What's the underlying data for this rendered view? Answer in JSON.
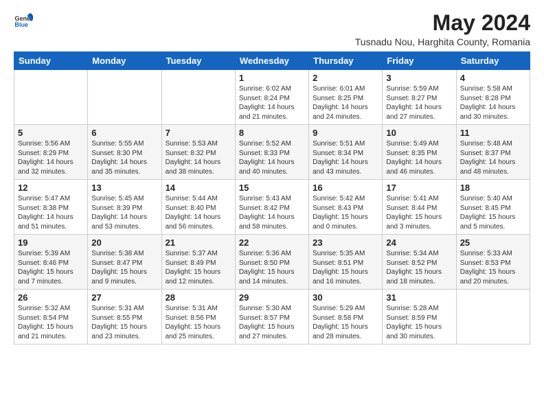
{
  "logo": {
    "general": "General",
    "blue": "Blue"
  },
  "title": "May 2024",
  "subtitle": "Tusnadu Nou, Harghita County, Romania",
  "weekdays": [
    "Sunday",
    "Monday",
    "Tuesday",
    "Wednesday",
    "Thursday",
    "Friday",
    "Saturday"
  ],
  "weeks": [
    [
      {
        "day": "",
        "content": ""
      },
      {
        "day": "",
        "content": ""
      },
      {
        "day": "",
        "content": ""
      },
      {
        "day": "1",
        "content": "Sunrise: 6:02 AM\nSunset: 8:24 PM\nDaylight: 14 hours\nand 21 minutes."
      },
      {
        "day": "2",
        "content": "Sunrise: 6:01 AM\nSunset: 8:25 PM\nDaylight: 14 hours\nand 24 minutes."
      },
      {
        "day": "3",
        "content": "Sunrise: 5:59 AM\nSunset: 8:27 PM\nDaylight: 14 hours\nand 27 minutes."
      },
      {
        "day": "4",
        "content": "Sunrise: 5:58 AM\nSunset: 8:28 PM\nDaylight: 14 hours\nand 30 minutes."
      }
    ],
    [
      {
        "day": "5",
        "content": "Sunrise: 5:56 AM\nSunset: 8:29 PM\nDaylight: 14 hours\nand 32 minutes."
      },
      {
        "day": "6",
        "content": "Sunrise: 5:55 AM\nSunset: 8:30 PM\nDaylight: 14 hours\nand 35 minutes."
      },
      {
        "day": "7",
        "content": "Sunrise: 5:53 AM\nSunset: 8:32 PM\nDaylight: 14 hours\nand 38 minutes."
      },
      {
        "day": "8",
        "content": "Sunrise: 5:52 AM\nSunset: 8:33 PM\nDaylight: 14 hours\nand 40 minutes."
      },
      {
        "day": "9",
        "content": "Sunrise: 5:51 AM\nSunset: 8:34 PM\nDaylight: 14 hours\nand 43 minutes."
      },
      {
        "day": "10",
        "content": "Sunrise: 5:49 AM\nSunset: 8:35 PM\nDaylight: 14 hours\nand 46 minutes."
      },
      {
        "day": "11",
        "content": "Sunrise: 5:48 AM\nSunset: 8:37 PM\nDaylight: 14 hours\nand 48 minutes."
      }
    ],
    [
      {
        "day": "12",
        "content": "Sunrise: 5:47 AM\nSunset: 8:38 PM\nDaylight: 14 hours\nand 51 minutes."
      },
      {
        "day": "13",
        "content": "Sunrise: 5:45 AM\nSunset: 8:39 PM\nDaylight: 14 hours\nand 53 minutes."
      },
      {
        "day": "14",
        "content": "Sunrise: 5:44 AM\nSunset: 8:40 PM\nDaylight: 14 hours\nand 56 minutes."
      },
      {
        "day": "15",
        "content": "Sunrise: 5:43 AM\nSunset: 8:42 PM\nDaylight: 14 hours\nand 58 minutes."
      },
      {
        "day": "16",
        "content": "Sunrise: 5:42 AM\nSunset: 8:43 PM\nDaylight: 15 hours\nand 0 minutes."
      },
      {
        "day": "17",
        "content": "Sunrise: 5:41 AM\nSunset: 8:44 PM\nDaylight: 15 hours\nand 3 minutes."
      },
      {
        "day": "18",
        "content": "Sunrise: 5:40 AM\nSunset: 8:45 PM\nDaylight: 15 hours\nand 5 minutes."
      }
    ],
    [
      {
        "day": "19",
        "content": "Sunrise: 5:39 AM\nSunset: 8:46 PM\nDaylight: 15 hours\nand 7 minutes."
      },
      {
        "day": "20",
        "content": "Sunrise: 5:38 AM\nSunset: 8:47 PM\nDaylight: 15 hours\nand 9 minutes."
      },
      {
        "day": "21",
        "content": "Sunrise: 5:37 AM\nSunset: 8:49 PM\nDaylight: 15 hours\nand 12 minutes."
      },
      {
        "day": "22",
        "content": "Sunrise: 5:36 AM\nSunset: 8:50 PM\nDaylight: 15 hours\nand 14 minutes."
      },
      {
        "day": "23",
        "content": "Sunrise: 5:35 AM\nSunset: 8:51 PM\nDaylight: 15 hours\nand 16 minutes."
      },
      {
        "day": "24",
        "content": "Sunrise: 5:34 AM\nSunset: 8:52 PM\nDaylight: 15 hours\nand 18 minutes."
      },
      {
        "day": "25",
        "content": "Sunrise: 5:33 AM\nSunset: 8:53 PM\nDaylight: 15 hours\nand 20 minutes."
      }
    ],
    [
      {
        "day": "26",
        "content": "Sunrise: 5:32 AM\nSunset: 8:54 PM\nDaylight: 15 hours\nand 21 minutes."
      },
      {
        "day": "27",
        "content": "Sunrise: 5:31 AM\nSunset: 8:55 PM\nDaylight: 15 hours\nand 23 minutes."
      },
      {
        "day": "28",
        "content": "Sunrise: 5:31 AM\nSunset: 8:56 PM\nDaylight: 15 hours\nand 25 minutes."
      },
      {
        "day": "29",
        "content": "Sunrise: 5:30 AM\nSunset: 8:57 PM\nDaylight: 15 hours\nand 27 minutes."
      },
      {
        "day": "30",
        "content": "Sunrise: 5:29 AM\nSunset: 8:58 PM\nDaylight: 15 hours\nand 28 minutes."
      },
      {
        "day": "31",
        "content": "Sunrise: 5:28 AM\nSunset: 8:59 PM\nDaylight: 15 hours\nand 30 minutes."
      },
      {
        "day": "",
        "content": ""
      }
    ]
  ]
}
